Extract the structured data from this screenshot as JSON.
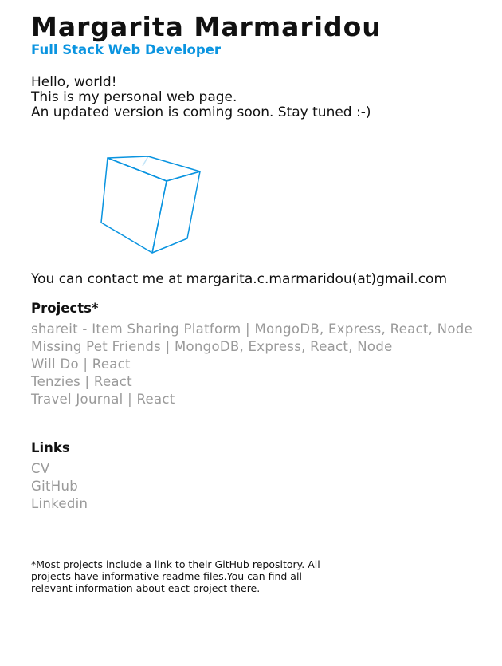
{
  "header": {
    "name": "Margarita Marmaridou",
    "role": "Full Stack Web Developer"
  },
  "intro": {
    "lines": [
      "Hello, world!",
      "This is my personal web page.",
      "An updated version is coming soon. Stay tuned :-)"
    ]
  },
  "graphic": {
    "icon": "wireframe-cube-icon",
    "stroke_color": "#0a94e0"
  },
  "contact": {
    "text": "You can contact me at margarita.c.marmaridou(at)gmail.com"
  },
  "projects": {
    "title": "Projects*",
    "items": [
      "shareit - Item Sharing Platform | MongoDB, Express, React, Node",
      "Missing Pet Friends | MongoDB, Express, React, Node",
      "Will Do | React",
      "Tenzies | React",
      "Travel Journal | React"
    ]
  },
  "links": {
    "title": "Links",
    "items": [
      "CV",
      "GitHub",
      "Linkedin"
    ]
  },
  "footnote": {
    "text": "*Most projects include a link to their GitHub repository. All projects have informative readme files.You can find all relevant information about eact project there."
  },
  "colors": {
    "accent": "#0a94e0",
    "text": "#111111",
    "muted": "#9a9a9a"
  }
}
